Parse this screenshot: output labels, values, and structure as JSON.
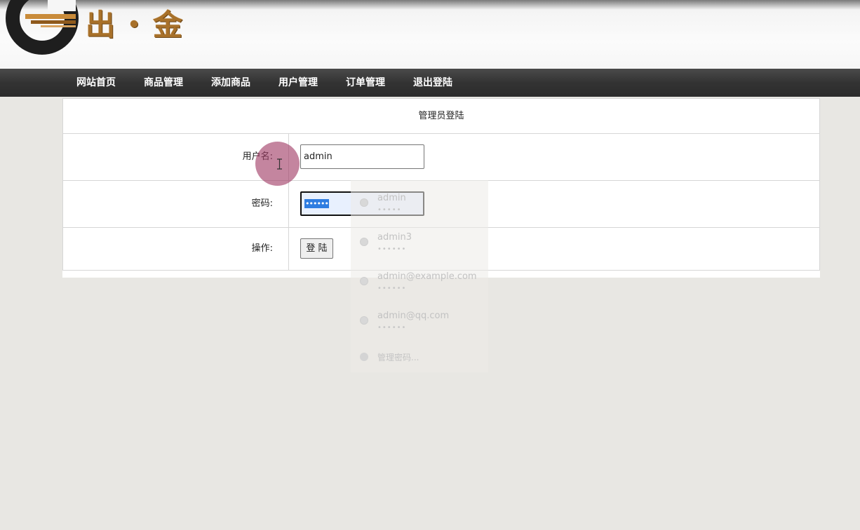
{
  "header": {
    "logo_text": "出・金",
    "brand_color": "#a8712a"
  },
  "nav": {
    "items": [
      {
        "label": "网站首页"
      },
      {
        "label": "商品管理"
      },
      {
        "label": "添加商品"
      },
      {
        "label": "用户管理"
      },
      {
        "label": "订单管理"
      },
      {
        "label": "退出登陆"
      }
    ]
  },
  "login": {
    "title": "管理员登陆",
    "username_label": "用户名:",
    "username_value": "admin",
    "password_label": "密码:",
    "password_value": "••••••",
    "operation_label": "操作:",
    "submit_label": "登 陆"
  },
  "autofill": {
    "entries": [
      {
        "username": "admin",
        "password_mask": "•••••"
      },
      {
        "username": "admin3",
        "password_mask": "••••••"
      },
      {
        "username": "admin@example.com",
        "password_mask": "••••••"
      },
      {
        "username": "admin@qq.com",
        "password_mask": "••••••"
      }
    ],
    "manage_label": "管理密码..."
  },
  "colors": {
    "page_bg": "#e8e7e3",
    "nav_bg": "#333333",
    "selection": "#2f7de1",
    "cursor_highlight": "#a03a64"
  }
}
